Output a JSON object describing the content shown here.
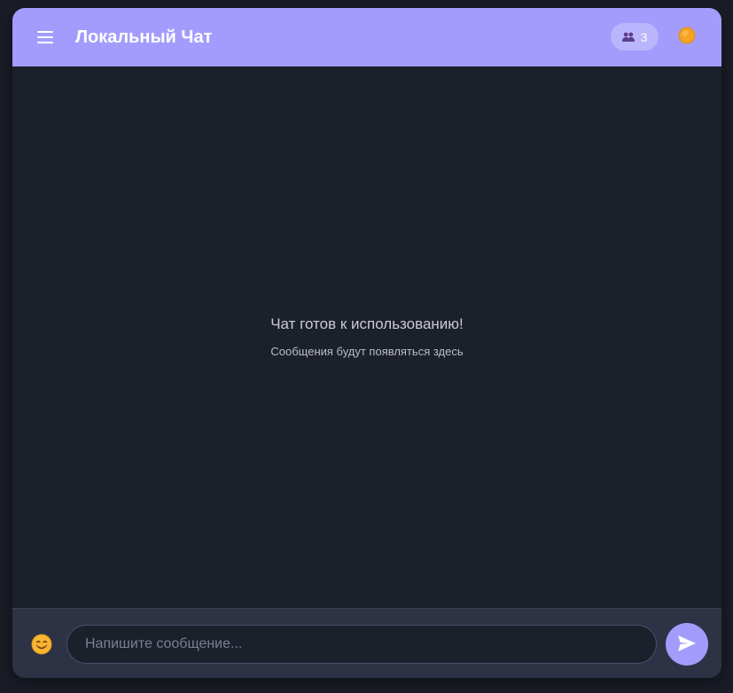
{
  "header": {
    "menu_icon": "hamburger-menu-icon",
    "title": "Локальный Чат",
    "users_icon": "users-icon",
    "users_count": "3",
    "theme_icon": "sun-icon"
  },
  "messages": {
    "empty_title": "Чат готов к использованию!",
    "empty_subtitle": "Сообщения будут появляться здесь"
  },
  "composer": {
    "emoji_icon": "smiling-face-emoji-icon",
    "input_value": "",
    "input_placeholder": "Напишите сообщение...",
    "send_icon": "send-arrow-icon"
  },
  "colors": {
    "accent": "#a49cfc",
    "background": "#1c202b",
    "composer": "#2d3345",
    "sun": "#f5a524"
  }
}
